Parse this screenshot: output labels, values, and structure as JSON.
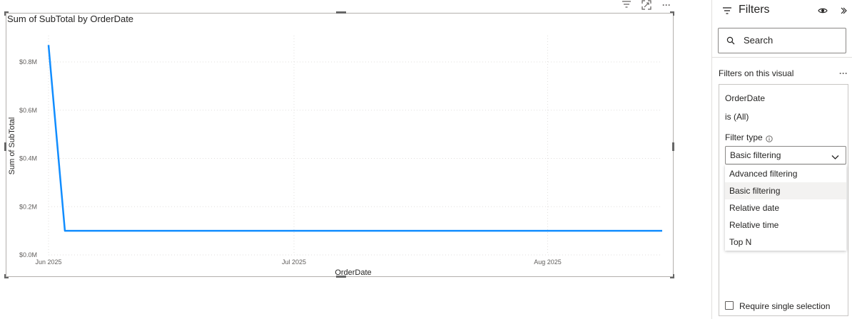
{
  "visual": {
    "title": "Sum of SubTotal by OrderDate",
    "header_icons": [
      "filter-icon",
      "focus-mode-icon",
      "more-options-icon"
    ],
    "more_glyph": "···"
  },
  "chart_data": {
    "type": "line",
    "title": "Sum of SubTotal by OrderDate",
    "xlabel": "OrderDate",
    "ylabel": "Sum of SubTotal",
    "x_ticks": [
      "Jun 2025",
      "Jul 2025",
      "Aug 2025"
    ],
    "y_ticks": [
      "$0.0M",
      "$0.2M",
      "$0.4M",
      "$0.6M",
      "$0.8M"
    ],
    "ylim": [
      0,
      0.9
    ],
    "x_domain": [
      "2025-06-01",
      "2025-08-15"
    ],
    "series": [
      {
        "color": "#118dff",
        "points": [
          {
            "x": "2025-06-01",
            "y": 0.87
          },
          {
            "x": "2025-06-03",
            "y": 0.1
          },
          {
            "x": "2025-08-15",
            "y": 0.1
          }
        ]
      }
    ],
    "grid": true
  },
  "filters": {
    "title": "Filters",
    "search_placeholder": "Search",
    "section_label": "Filters on this visual",
    "section_more": "···",
    "card": {
      "field": "OrderDate",
      "status": "is (All)",
      "filter_type_label": "Filter type",
      "selected_type": "Basic filtering",
      "options": [
        "Advanced filtering",
        "Basic filtering",
        "Relative date",
        "Relative time",
        "Top N"
      ],
      "hovered_option": "Basic filtering",
      "require_single_selection": "Require single selection"
    }
  }
}
